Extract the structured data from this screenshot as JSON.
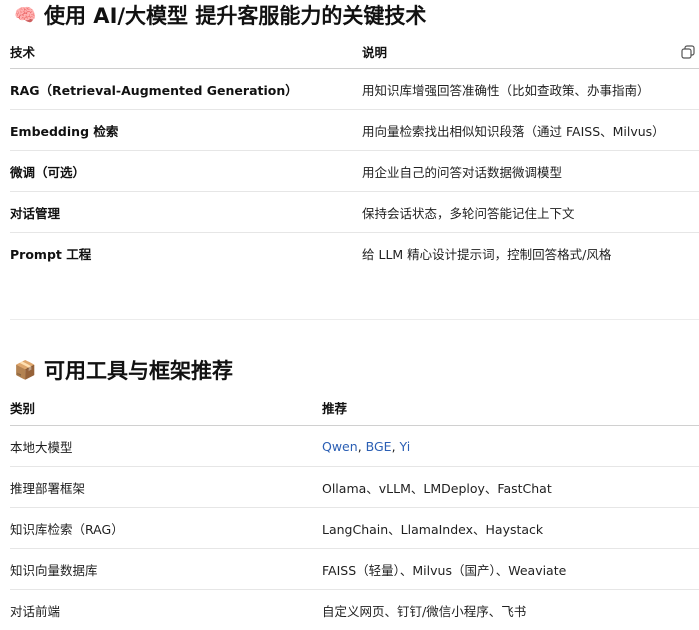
{
  "section1": {
    "emoji": "🧠",
    "title": "使用 AI/大模型 提升客服能力的关键技术",
    "headers": [
      "技术",
      "说明"
    ],
    "rows": [
      {
        "tech": "RAG（Retrieval-Augmented Generation）",
        "desc": "用知识库增强回答准确性（比如查政策、办事指南）"
      },
      {
        "tech": "Embedding 检索",
        "desc": "用向量检索找出相似知识段落（通过 FAISS、Milvus）"
      },
      {
        "tech": "微调（可选）",
        "desc": "用企业自己的问答对话数据微调模型"
      },
      {
        "tech": "对话管理",
        "desc": "保持会话状态，多轮问答能记住上下文"
      },
      {
        "tech": "Prompt 工程",
        "desc": "给 LLM 精心设计提示词，控制回答格式/风格"
      }
    ]
  },
  "section2": {
    "emoji": "📦",
    "title": "可用工具与框架推荐",
    "headers": [
      "类别",
      "推荐"
    ],
    "rows": [
      {
        "cat": "本地大模型",
        "links": [
          "Qwen",
          "BGE",
          "Yi"
        ],
        "sep": ", "
      },
      {
        "cat": "推理部署框架",
        "rec": "Ollama、vLLM、LMDeploy、FastChat"
      },
      {
        "cat": "知识库检索（RAG）",
        "rec": "LangChain、LlamaIndex、Haystack"
      },
      {
        "cat": "知识向量数据库",
        "rec": "FAISS（轻量）、Milvus（国产）、Weaviate"
      },
      {
        "cat": "对话前端",
        "rec": "自定义网页、钉钉/微信小程序、飞书"
      }
    ]
  },
  "colors": {
    "link": "#2b5fb4",
    "border": "#e6e6e6"
  },
  "icons": {
    "copy": "copy-icon"
  }
}
